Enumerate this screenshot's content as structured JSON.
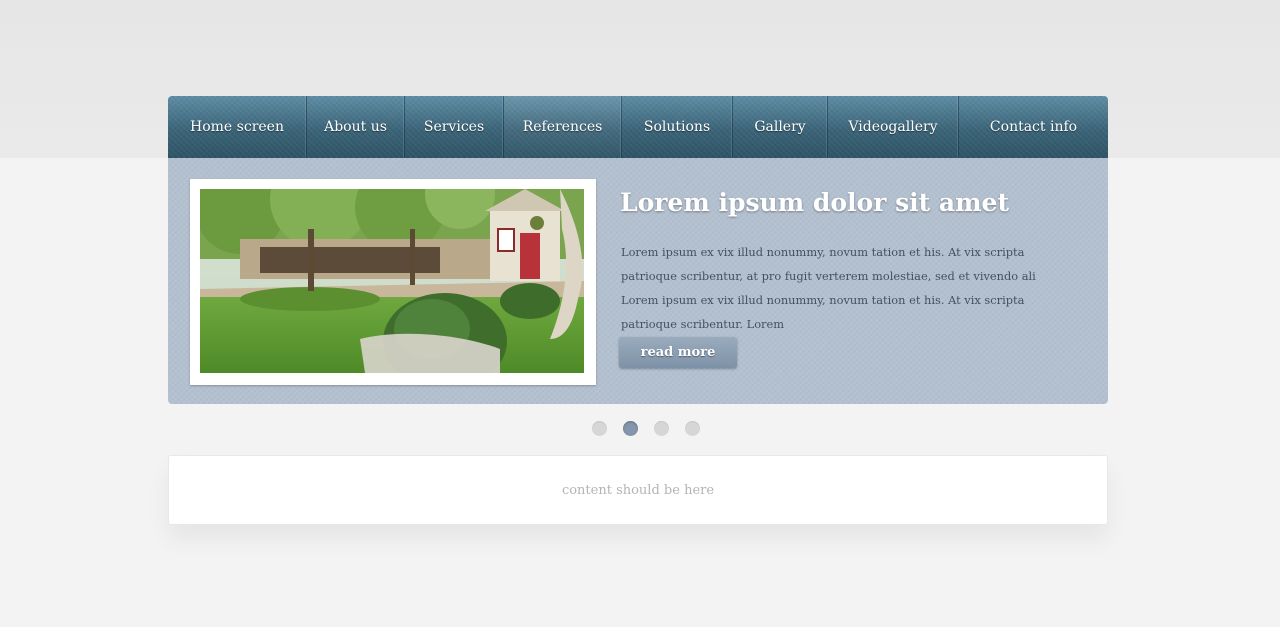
{
  "nav": {
    "items": [
      {
        "label": "Home screen"
      },
      {
        "label": "About us"
      },
      {
        "label": "Services"
      },
      {
        "label": "References"
      },
      {
        "label": "Solutions"
      },
      {
        "label": "Gallery"
      },
      {
        "label": "Videogallery"
      },
      {
        "label": "Contact info"
      }
    ]
  },
  "slide": {
    "title": "Lorem ipsum dolor sit amet",
    "text": "Lorem ipsum ex vix illud nonummy, novum tation et his. At vix scripta patrioque scribentur, at pro fugit verterem molestiae, sed et vivendo ali Lorem ipsum ex vix illud nonummy, novum tation et his. At vix scripta patrioque scribentur. Lorem",
    "button_label": "read more"
  },
  "pager": {
    "count": 4,
    "active_index": 1
  },
  "content": {
    "placeholder": "content should be here"
  },
  "colors": {
    "nav": "#3b6478",
    "slider_bg": "#b3c0cf",
    "button": "#8a9cb0",
    "dot_active": "#8496ac",
    "dot_inactive": "#d6d6d6"
  }
}
